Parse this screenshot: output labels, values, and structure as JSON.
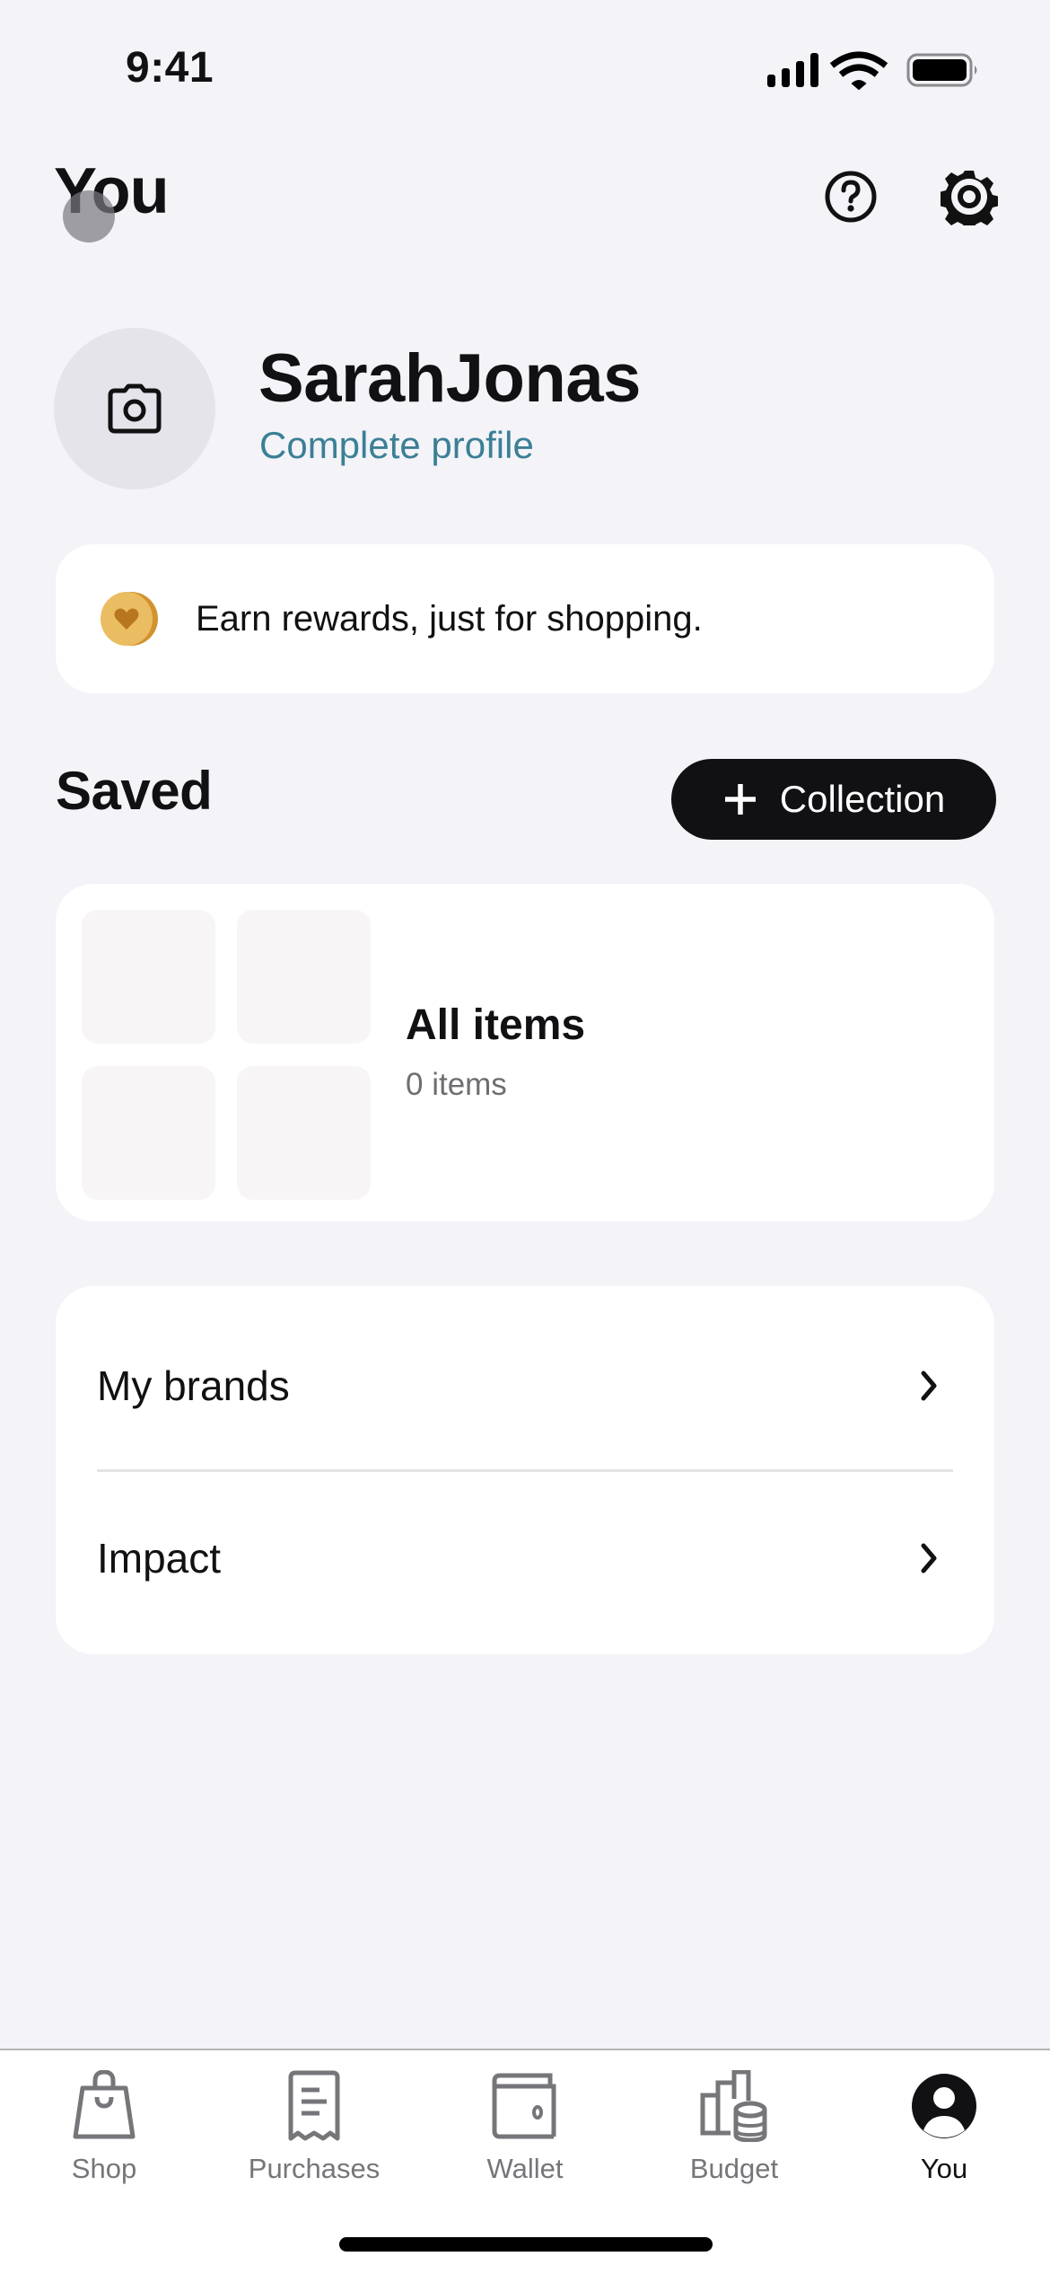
{
  "status_bar": {
    "time": "9:41",
    "icons": [
      "cellular-signal-icon",
      "wifi-icon",
      "battery-icon"
    ]
  },
  "header": {
    "title": "You",
    "actions": [
      {
        "name": "help",
        "icon": "question-circle-icon"
      },
      {
        "name": "settings",
        "icon": "gear-icon"
      }
    ]
  },
  "profile": {
    "avatar_icon": "camera-icon",
    "name": "SarahJonas",
    "complete_link": "Complete profile",
    "link_color": "#3b7f95"
  },
  "rewards": {
    "icon": "heart-coin-icon",
    "text": "Earn rewards, just for shopping."
  },
  "saved": {
    "title": "Saved",
    "add_button_label": "Collection",
    "add_button_icon": "plus-icon",
    "collections": [
      {
        "title": "All items",
        "count_label": "0 items"
      }
    ]
  },
  "menu": {
    "items": [
      {
        "label": "My brands",
        "icon": "chevron-right-icon"
      },
      {
        "label": "Impact",
        "icon": "chevron-right-icon"
      }
    ]
  },
  "tab_bar": {
    "active": "You",
    "tabs": [
      {
        "label": "Shop",
        "icon": "shopping-bag-icon"
      },
      {
        "label": "Purchases",
        "icon": "receipt-icon"
      },
      {
        "label": "Wallet",
        "icon": "wallet-icon"
      },
      {
        "label": "Budget",
        "icon": "budget-chart-icon"
      },
      {
        "label": "You",
        "icon": "person-circle-icon"
      }
    ]
  },
  "colors": {
    "background": "#f3f3f8",
    "card": "#ffffff",
    "primary_text": "#111114",
    "secondary_text": "#6e6e72",
    "tab_inactive": "#76767a",
    "coin": "#e8b154"
  }
}
